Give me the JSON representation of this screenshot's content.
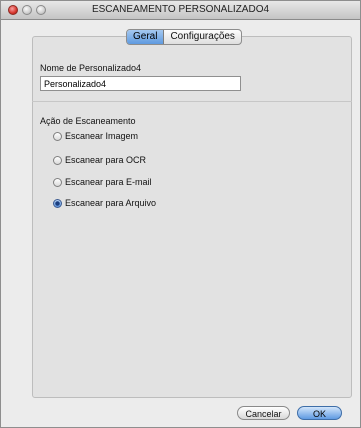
{
  "window": {
    "title": "ESCANEAMENTO PERSONALIZADO4"
  },
  "tabs": [
    {
      "label": "Geral",
      "selected": true
    },
    {
      "label": "Configurações",
      "selected": false
    }
  ],
  "name_section": {
    "label": "Nome de Personalizado4",
    "value": "Personalizado4"
  },
  "action_section": {
    "label": "Ação de Escaneamento",
    "options": [
      {
        "label": "Escanear Imagem",
        "selected": false
      },
      {
        "label": "Escanear para OCR",
        "selected": false
      },
      {
        "label": "Escanear para E-mail",
        "selected": false
      },
      {
        "label": "Escanear para Arquivo",
        "selected": true
      }
    ]
  },
  "buttons": {
    "cancel": "Cancelar",
    "ok": "OK"
  },
  "colors": {
    "accent": "#5f9ae2",
    "close": "#d7362e"
  }
}
